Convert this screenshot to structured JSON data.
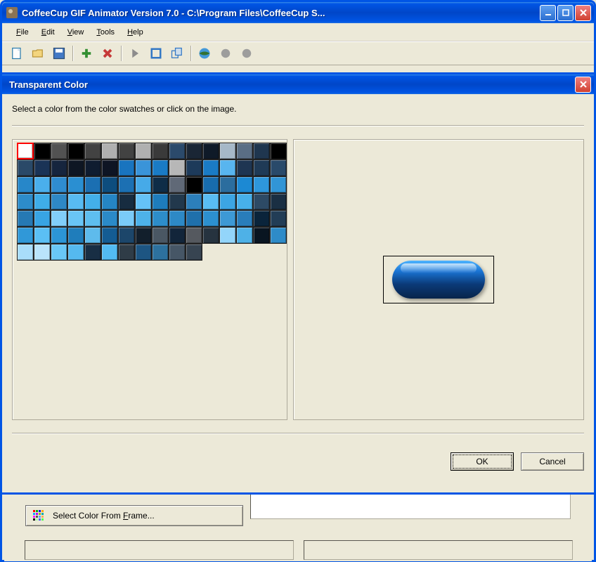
{
  "main_window": {
    "title": "CoffeeCup GIF Animator Version 7.0 - C:\\Program Files\\CoffeeCup S..."
  },
  "menubar": {
    "file": "File",
    "edit": "Edit",
    "view": "View",
    "tools": "Tools",
    "help": "Help"
  },
  "dialog": {
    "title": "Transparent Color",
    "instruction": "Select a color from the color swatches or click on the image.",
    "ok_label": "OK",
    "cancel_label": "Cancel"
  },
  "swatches": [
    "#ffffff",
    "#000000",
    "#525252",
    "#000000",
    "#424242",
    "#b0b0b0",
    "#424242",
    "#b0b0b0",
    "#3a3a3a",
    "#2b4a6b",
    "#1a2635",
    "#0f1a28",
    "#a6b8c8",
    "#5a6e85",
    "#1f364f",
    "#000000",
    "#2a4968",
    "#1a3356",
    "#16253e",
    "#0e1623",
    "#0f1c30",
    "#0e1524",
    "#1974bf",
    "#3a94d9",
    "#1a7bc5",
    "#b7b7b7",
    "#1d3a5a",
    "#1a7bc5",
    "#58b5ef",
    "#1e3552",
    "#1f3a56",
    "#294a6a",
    "#2787c9",
    "#4aafec",
    "#2f8cd0",
    "#2a8fd2",
    "#1b6fb2",
    "#0d4d7e",
    "#1c70b3",
    "#46aae8",
    "#0f2d47",
    "#606977",
    "#000000",
    "#186cad",
    "#2b6d9e",
    "#1c89d3",
    "#2e97dc",
    "#3195d6",
    "#2d8cca",
    "#3fade8",
    "#2e88c5",
    "#58bbf2",
    "#43afea",
    "#2585c4",
    "#172c40",
    "#65c2f7",
    "#1e7cbc",
    "#22384c",
    "#2c7fbb",
    "#59bdf3",
    "#3ca5e3",
    "#47b0ea",
    "#2d4a65",
    "#1a2f43",
    "#2679b4",
    "#38a4e3",
    "#81cef9",
    "#69c5f6",
    "#5ebeef",
    "#2b8ac8",
    "#7acbf8",
    "#4db2e9",
    "#2d8dca",
    "#2d89c6",
    "#1f70ab",
    "#2c90cf",
    "#3d99d5",
    "#297dba",
    "#0a243b",
    "#223d56",
    "#3098d8",
    "#5bbff4",
    "#2c95d6",
    "#1f7dbb",
    "#5ebbec",
    "#145c93",
    "#1c466a",
    "#121f2c",
    "#4a5763",
    "#12253a",
    "#55595f",
    "#26333f",
    "#93d5fa",
    "#4eb1e7",
    "#091521",
    "#2e8bc8",
    "#a9ddfb",
    "#bae4fc",
    "#69c7f7",
    "#55b9ef",
    "#182e44",
    "#53bbf2",
    "#2f3c47",
    "#1d5582",
    "#2d719e",
    "#465666",
    "#374451",
    "#FFFFFF",
    "#FFFFFF",
    "#FFFFFF",
    "#FFFFFF",
    "#FFFFFF"
  ],
  "swatch_count": 107,
  "bottom": {
    "select_color_label": "Select Color From Frame..."
  },
  "grid_icon_colors": [
    "#f00",
    "#0a0",
    "#00f",
    "#fa0",
    "#0af",
    "#a0f",
    "#aa0",
    "#0aa",
    "#f0f",
    "#555",
    "#5af",
    "#fa5",
    "#000",
    "#afa",
    "#55f",
    "#5f5"
  ]
}
